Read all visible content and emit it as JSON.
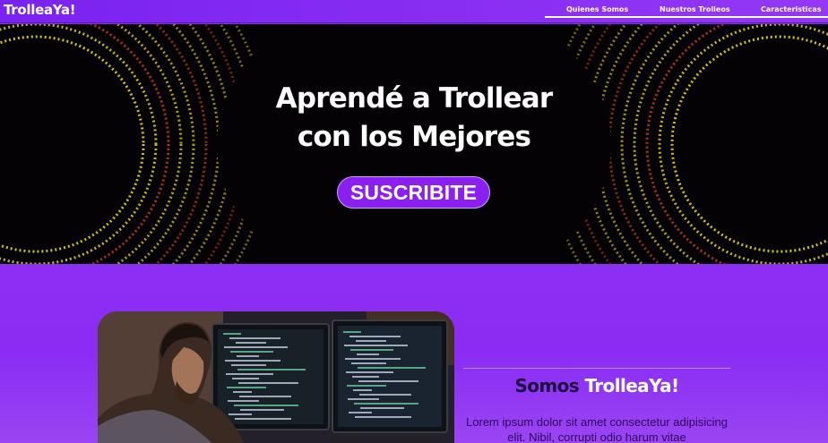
{
  "navbar": {
    "brand": "TrolleaYa!",
    "links": [
      {
        "label": "Quienes Somos"
      },
      {
        "label": "Nuestros Trolleos"
      },
      {
        "label": "Caracteristicas"
      }
    ]
  },
  "hero": {
    "title_line1": "Aprendé a Trollear",
    "title_line2": "con los Mejores",
    "cta_label": "SUSCRIBITE",
    "ring_colors": {
      "primary": "#f2e21a",
      "secondary": "#d9432a"
    }
  },
  "about": {
    "title_prefix": "Somos ",
    "title_brand": "TrolleaYa!",
    "body": "Lorem ipsum dolor sit amet consectetur adipisicing elit. Nibil, corrupti odio harum vitae",
    "image_icon": "developer-at-monitors-photo"
  },
  "colors": {
    "accent": "#8a2cf3",
    "button": "#8a1ff0",
    "hero_bg": "#050205"
  }
}
